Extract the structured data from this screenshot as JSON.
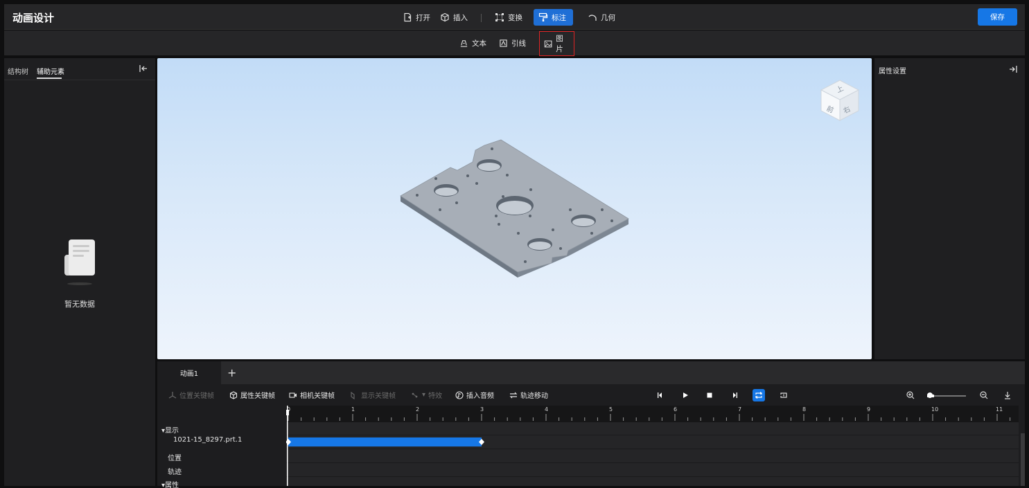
{
  "app": {
    "title": "动画设计",
    "save_label": "保存"
  },
  "toolbar": {
    "open": "打开",
    "insert": "插入",
    "transform": "变换",
    "annotate": "标注",
    "geometry": "几何"
  },
  "subtoolbar": {
    "text": "文本",
    "leader": "引线",
    "image": "图片"
  },
  "left_panel": {
    "tabs": [
      "结构树",
      "辅助元素"
    ],
    "active_tab": "辅助元素",
    "empty_text": "暂无数据"
  },
  "right_panel": {
    "title": "属性设置"
  },
  "viewcube": {
    "top": "上",
    "front": "前",
    "right": "右"
  },
  "timeline": {
    "tabs": [
      "动画1"
    ],
    "tools": {
      "position_keyframe": "位置关键帧",
      "property_keyframe": "属性关键帧",
      "camera_keyframe": "相机关键帧",
      "display_keyframe": "显示关键帧",
      "effect": "特效",
      "insert_audio": "插入音频",
      "path_move": "轨迹移动"
    },
    "ruler_ticks": [
      "0",
      "1",
      "2",
      "3",
      "4",
      "5",
      "6",
      "7",
      "8",
      "9",
      "10",
      "11"
    ],
    "tracks": {
      "display_group": "显示",
      "part_name": "1021-15_8297.prt.1",
      "position": "位置",
      "trajectory": "轨迹",
      "attributes_group": "属性"
    },
    "clip": {
      "start": 0,
      "end": 3
    }
  },
  "colors": {
    "accent": "#1677e6",
    "highlight": "#e02424"
  }
}
